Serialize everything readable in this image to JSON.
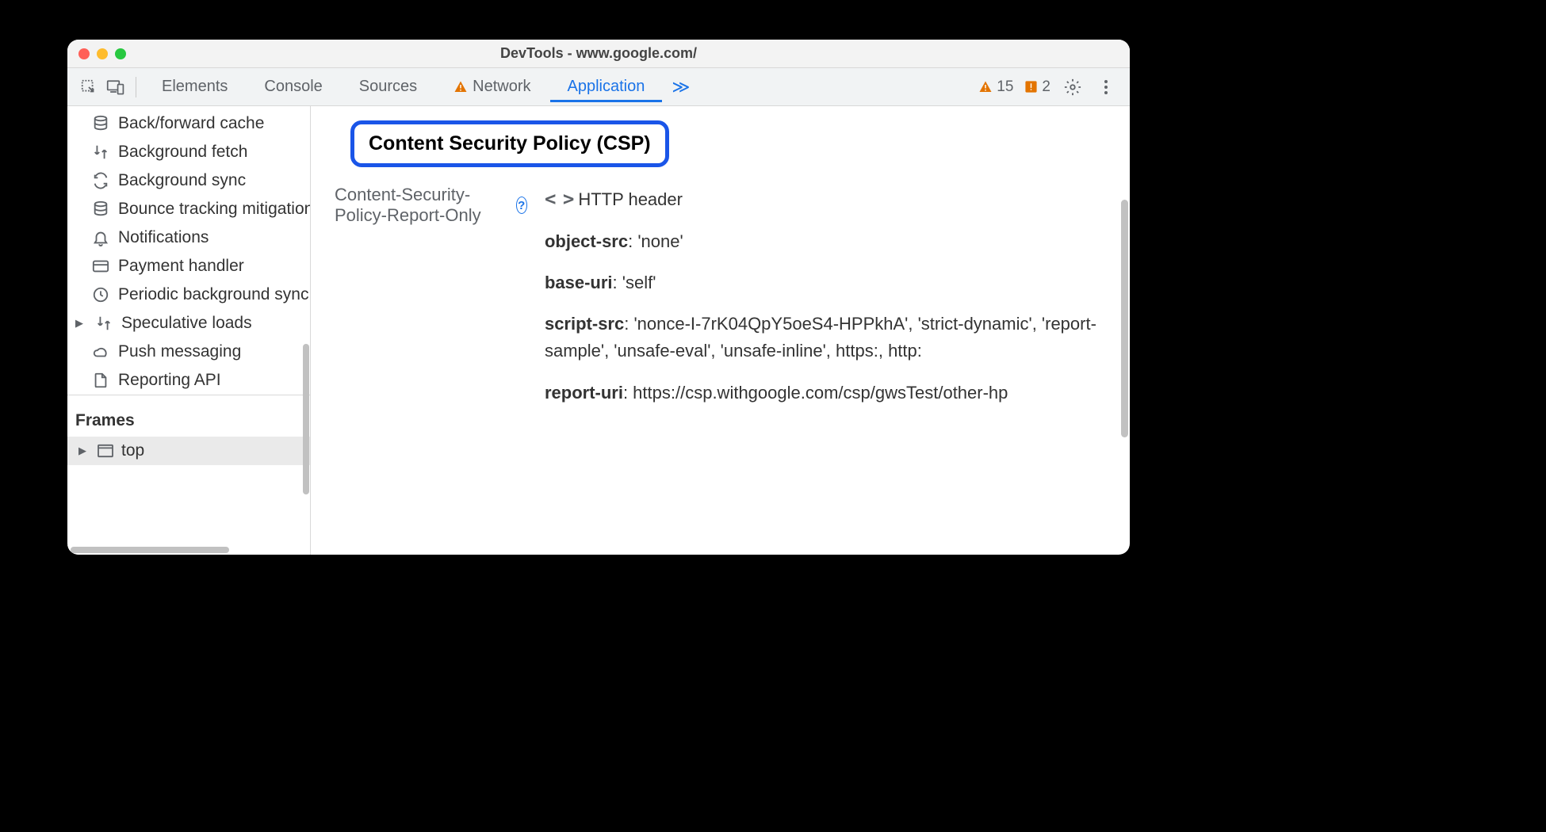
{
  "window": {
    "title": "DevTools - www.google.com/"
  },
  "tabs": {
    "items": [
      {
        "label": "Elements",
        "active": false,
        "warn": false
      },
      {
        "label": "Console",
        "active": false,
        "warn": false
      },
      {
        "label": "Sources",
        "active": false,
        "warn": false
      },
      {
        "label": "Network",
        "active": false,
        "warn": true
      },
      {
        "label": "Application",
        "active": true,
        "warn": false
      }
    ],
    "overflow": "≫"
  },
  "indicators": {
    "warnings_count": "15",
    "issues_count": "2"
  },
  "sidebar": {
    "items": [
      {
        "icon": "database-icon",
        "label": "Back/forward cache",
        "arrow": false
      },
      {
        "icon": "background-fetch-icon",
        "label": "Background fetch",
        "arrow": false
      },
      {
        "icon": "background-sync-icon",
        "label": "Background sync",
        "arrow": false
      },
      {
        "icon": "database-icon",
        "label": "Bounce tracking mitigation",
        "arrow": false
      },
      {
        "icon": "bell-icon",
        "label": "Notifications",
        "arrow": false
      },
      {
        "icon": "card-icon",
        "label": "Payment handler",
        "arrow": false
      },
      {
        "icon": "clock-icon",
        "label": "Periodic background sync",
        "arrow": false
      },
      {
        "icon": "background-fetch-icon",
        "label": "Speculative loads",
        "arrow": true
      },
      {
        "icon": "cloud-icon",
        "label": "Push messaging",
        "arrow": false
      },
      {
        "icon": "file-icon",
        "label": "Reporting API",
        "arrow": false
      }
    ],
    "frames_header": "Frames",
    "frames_top": "top"
  },
  "main": {
    "csp_heading": "Content Security Policy (CSP)",
    "csp_report_only_label": "Content-Security-Policy-Report-Only",
    "source_label": "HTTP header",
    "directives": [
      {
        "name": "object-src",
        "value": ": 'none'"
      },
      {
        "name": "base-uri",
        "value": ": 'self'"
      },
      {
        "name": "script-src",
        "value": ": 'nonce-I-7rK04QpY5oeS4-HPPkhA', 'strict-dynamic', 'report-sample', 'unsafe-eval', 'unsafe-inline', https:, http:"
      },
      {
        "name": "report-uri",
        "value": ": https://csp.withgoogle.com/csp/gwsTest/other-hp"
      }
    ]
  }
}
